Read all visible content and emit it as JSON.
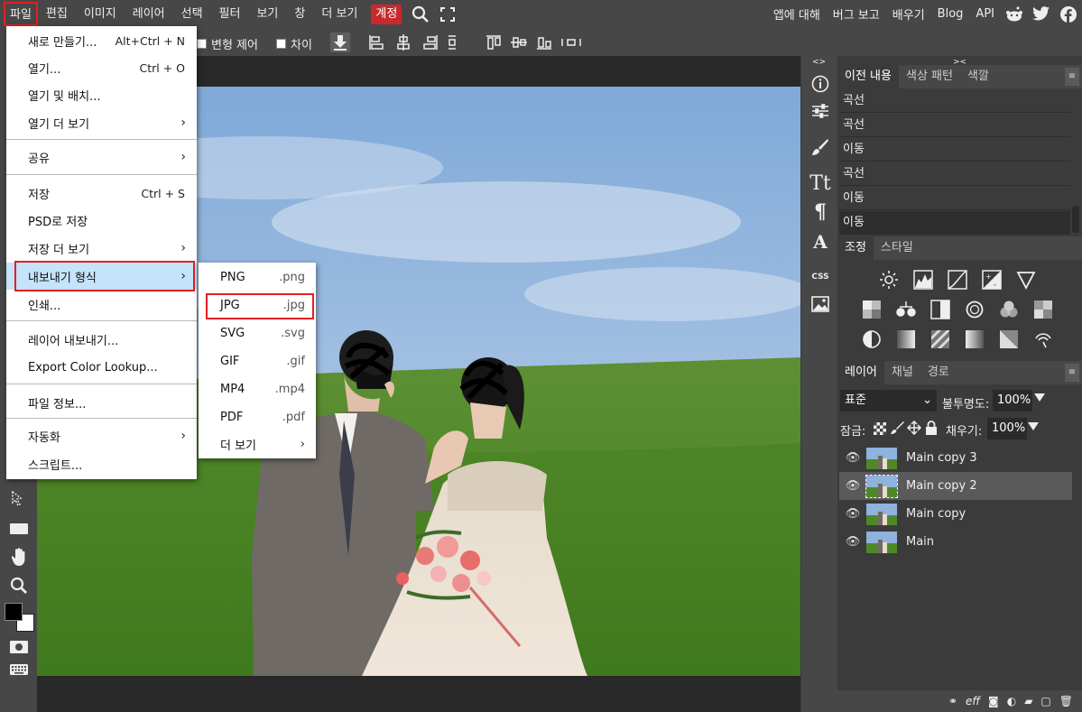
{
  "menubar": {
    "items": [
      "파일",
      "편집",
      "이미지",
      "레이어",
      "선택",
      "필터",
      "보기",
      "창",
      "더 보기",
      "계정"
    ],
    "right": [
      "앱에 대해",
      "버그 보고",
      "배우기",
      "Blog",
      "API"
    ]
  },
  "options": {
    "transform_label": "변형 제어",
    "distance_label": "차이"
  },
  "file_menu": {
    "items": [
      {
        "label": "새로 만들기...",
        "shortcut": "Alt+Ctrl + N"
      },
      {
        "label": "열기...",
        "shortcut": "Ctrl + O"
      },
      {
        "label": "열기 및 배치...",
        "shortcut": ""
      },
      {
        "label": "열기 더 보기",
        "shortcut": ""
      },
      {
        "label": "공유",
        "shortcut": ""
      },
      {
        "label": "저장",
        "shortcut": "Ctrl + S"
      },
      {
        "label": "PSD로 저장",
        "shortcut": ""
      },
      {
        "label": "저장 더 보기",
        "shortcut": ""
      },
      {
        "label": "내보내기 형식",
        "shortcut": ""
      },
      {
        "label": "인쇄...",
        "shortcut": ""
      },
      {
        "label": "레이어 내보내기...",
        "shortcut": ""
      },
      {
        "label": "Export Color Lookup...",
        "shortcut": ""
      },
      {
        "label": "파일 정보...",
        "shortcut": ""
      },
      {
        "label": "자동화",
        "shortcut": ""
      },
      {
        "label": "스크립트...",
        "shortcut": ""
      }
    ]
  },
  "export_submenu": {
    "items": [
      {
        "label": "PNG",
        "ext": ".png"
      },
      {
        "label": "JPG",
        "ext": ".jpg"
      },
      {
        "label": "SVG",
        "ext": ".svg"
      },
      {
        "label": "GIF",
        "ext": ".gif"
      },
      {
        "label": "MP4",
        "ext": ".mp4"
      },
      {
        "label": "PDF",
        "ext": ".pdf"
      },
      {
        "label": "더 보기",
        "ext": ""
      }
    ]
  },
  "history_panel": {
    "tabs": [
      "이전 내용",
      "색상 패턴",
      "색깔"
    ],
    "rows": [
      "곡선",
      "곡선",
      "이동",
      "곡선",
      "이동",
      "이동"
    ]
  },
  "adjust_panel": {
    "tabs": [
      "조정",
      "스타일"
    ]
  },
  "layers_panel": {
    "tabs": [
      "레이어",
      "채널",
      "경로"
    ],
    "blend_mode": "표준",
    "opacity_label": "불투명도:",
    "opacity_value": "100%",
    "lock_label": "잠금:",
    "fill_label": "채우기:",
    "fill_value": "100%",
    "layers": [
      "Main copy 3",
      "Main copy 2",
      "Main copy",
      "Main"
    ]
  },
  "colors": {
    "accent_red": "#e02020",
    "menu_highlight": "#c5e3fa",
    "account_bg": "#c9282d"
  }
}
